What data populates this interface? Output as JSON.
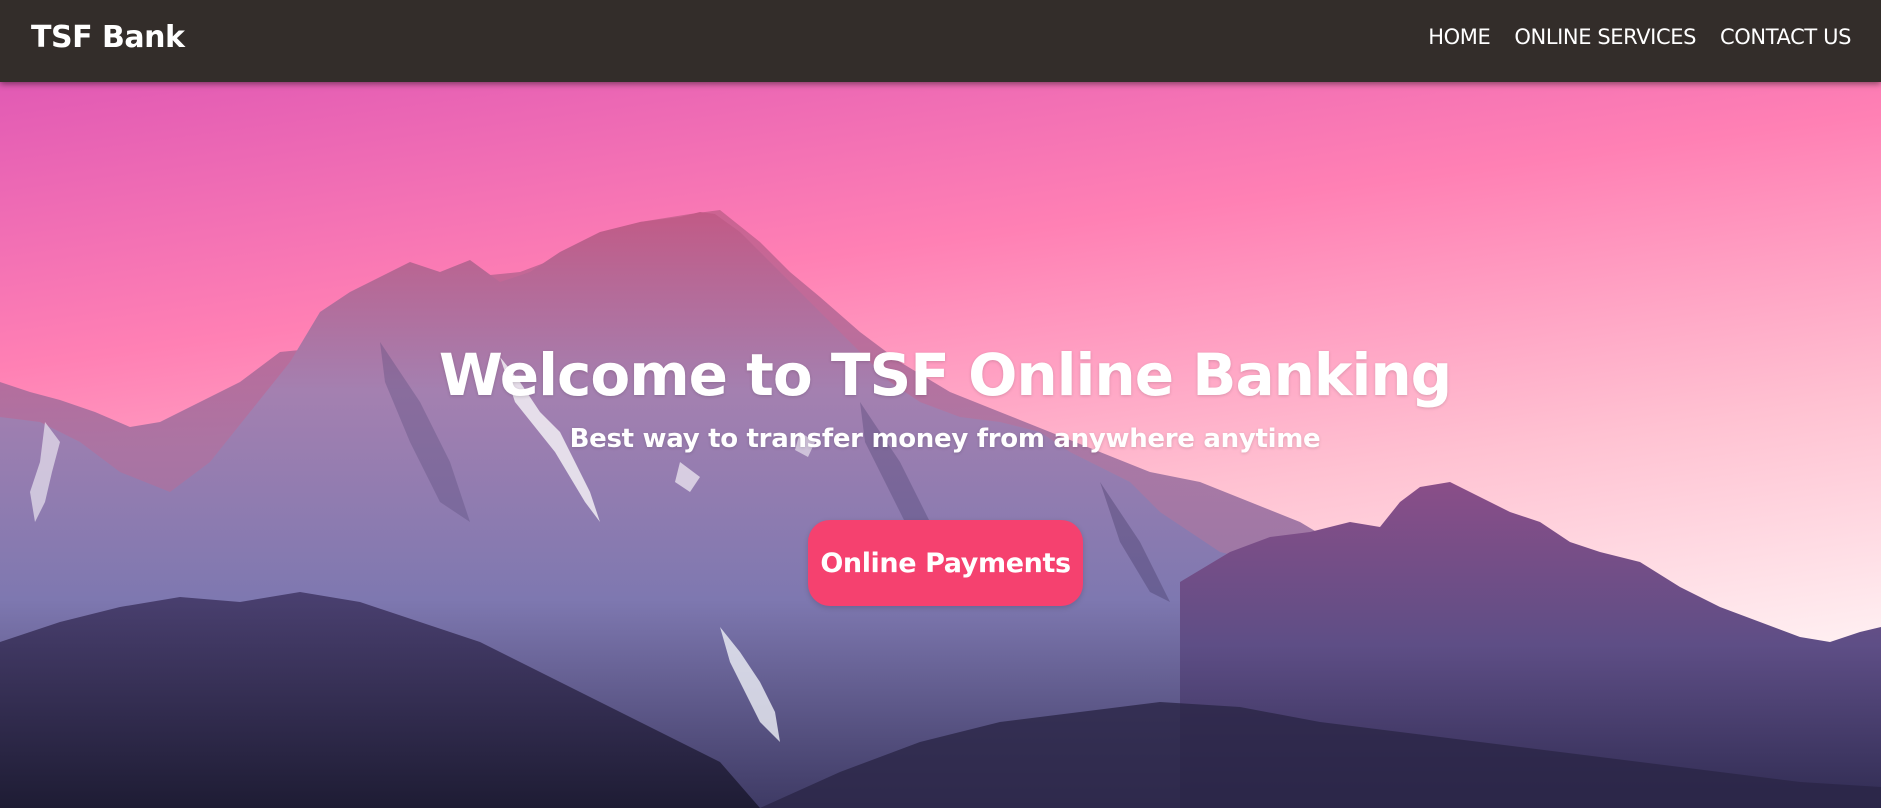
{
  "navbar": {
    "brand": "TSF Bank",
    "links": [
      {
        "label": "HOME"
      },
      {
        "label": "ONLINE SERVICES"
      },
      {
        "label": "CONTACT US"
      }
    ]
  },
  "hero": {
    "title": "Welcome to TSF Online Banking",
    "subtitle": "Best way to transfer money from anywhere anytime",
    "cta_label": "Online Payments",
    "background_description": "pink sky over purple mountain range"
  },
  "colors": {
    "navbar_bg": "#332d2a",
    "accent": "#f5416f",
    "sky_top": "#e55db0",
    "sky_bottom": "#fbe2ea",
    "mountain": "#6e5a9e"
  }
}
